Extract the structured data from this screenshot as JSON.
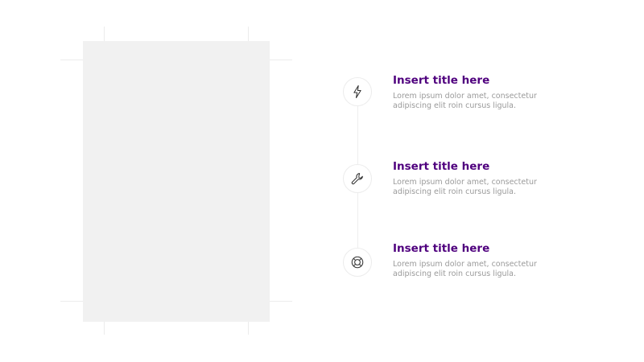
{
  "colors": {
    "title": "#4f007e",
    "body": "#9a9a9a",
    "placeholder": "#f1f1f1",
    "guide": "#ececec",
    "icon_stroke": "#333333"
  },
  "items": [
    {
      "icon": "lightning-bolt-icon",
      "title": "Insert title here",
      "body": "Lorem ipsum dolor amet, consectetur adipiscing elit roin cursus ligula."
    },
    {
      "icon": "wrench-icon",
      "title": "Insert title here",
      "body": "Lorem ipsum dolor amet, consectetur adipiscing elit roin cursus ligula."
    },
    {
      "icon": "lifebuoy-icon",
      "title": "Insert title here",
      "body": "Lorem ipsum dolor amet, consectetur adipiscing elit roin cursus ligula."
    }
  ]
}
